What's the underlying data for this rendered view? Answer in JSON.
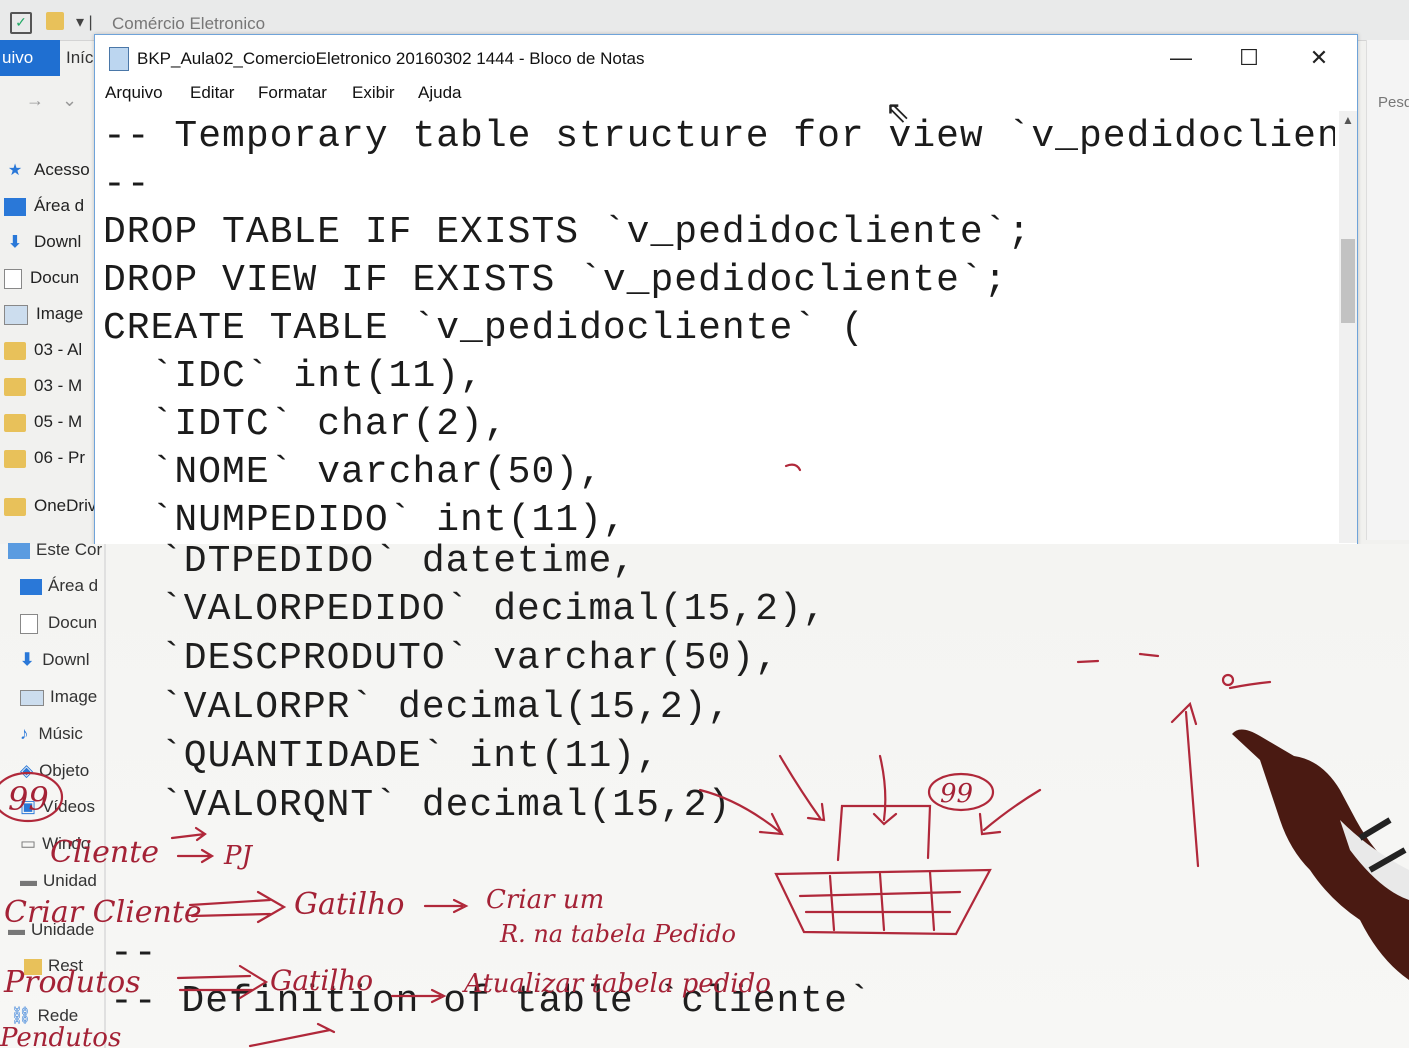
{
  "explorer": {
    "quick_access_title": "Comércio Eletronico",
    "file_tab": "uivo",
    "home_tab": "Iníc",
    "search_hint": "Pesq",
    "sidebar_items": [
      {
        "label": "Acesso",
        "icon": "star-icon"
      },
      {
        "label": "Área d",
        "icon": "desktop-icon"
      },
      {
        "label": "Downl",
        "icon": "download-icon"
      },
      {
        "label": "Docun",
        "icon": "document-icon"
      },
      {
        "label": "Image",
        "icon": "image-icon"
      },
      {
        "label": "03 - Al",
        "icon": "folder-icon"
      },
      {
        "label": "03 - M",
        "icon": "folder-icon"
      },
      {
        "label": "05 - M",
        "icon": "folder-icon"
      },
      {
        "label": "06 - Pr",
        "icon": "folder-icon"
      },
      {
        "label": "OneDriv",
        "icon": "cloud-icon"
      }
    ],
    "board_sidebar_items": [
      "Este Cor",
      "Área d",
      "Docun",
      "Downl",
      "Image",
      "Músic",
      "Objeto",
      "Vídeos",
      "Windo",
      "Unidad",
      "Unidade",
      "Rest",
      "Rede"
    ]
  },
  "notepad": {
    "title": "BKP_Aula02_ComercioEletronico 20160302 1444 - Bloco de Notas",
    "menu": [
      "Arquivo",
      "Editar",
      "Formatar",
      "Exibir",
      "Ajuda"
    ],
    "window_buttons": {
      "minimize": "—",
      "maximize": "☐",
      "close": "✕"
    },
    "lines": [
      "-- Temporary table structure for view `v_pedidoclient",
      "--",
      "DROP TABLE IF EXISTS `v_pedidocliente`;",
      "DROP VIEW IF EXISTS `v_pedidocliente`;",
      "CREATE TABLE `v_pedidocliente` (",
      "  `IDC` int(11),",
      "  `IDTC` char(2),",
      "  `NOME` varchar(50),",
      "  `NUMPEDIDO` int(11),"
    ]
  },
  "board": {
    "lines": [
      "`DTPEDIDO` datetime,",
      "`VALORPEDIDO` decimal(15,2),",
      "`DESCPRODUTO` varchar(50),",
      "`VALORPR` decimal(15,2),",
      "`QUANTIDADE` int(11),",
      "`VALORQNT` decimal(15,2)",
      "--",
      "-- Definition of table `cliente`"
    ],
    "annotations": {
      "note_99_left": "99",
      "note_99_right": "99",
      "cliente_line": "Cliente",
      "pj": "PJ",
      "gatilho_1": "Gatilho",
      "criar_um": "Criar um",
      "tabela_pedido": "R. na tabela Pedido",
      "criar_cliente": "Criar Cliente",
      "produtos": "Produtos",
      "gatilho_2": "Gatilho",
      "atualizar": "Atualizar tabela pedido",
      "pendutos": "Pendutos"
    }
  }
}
